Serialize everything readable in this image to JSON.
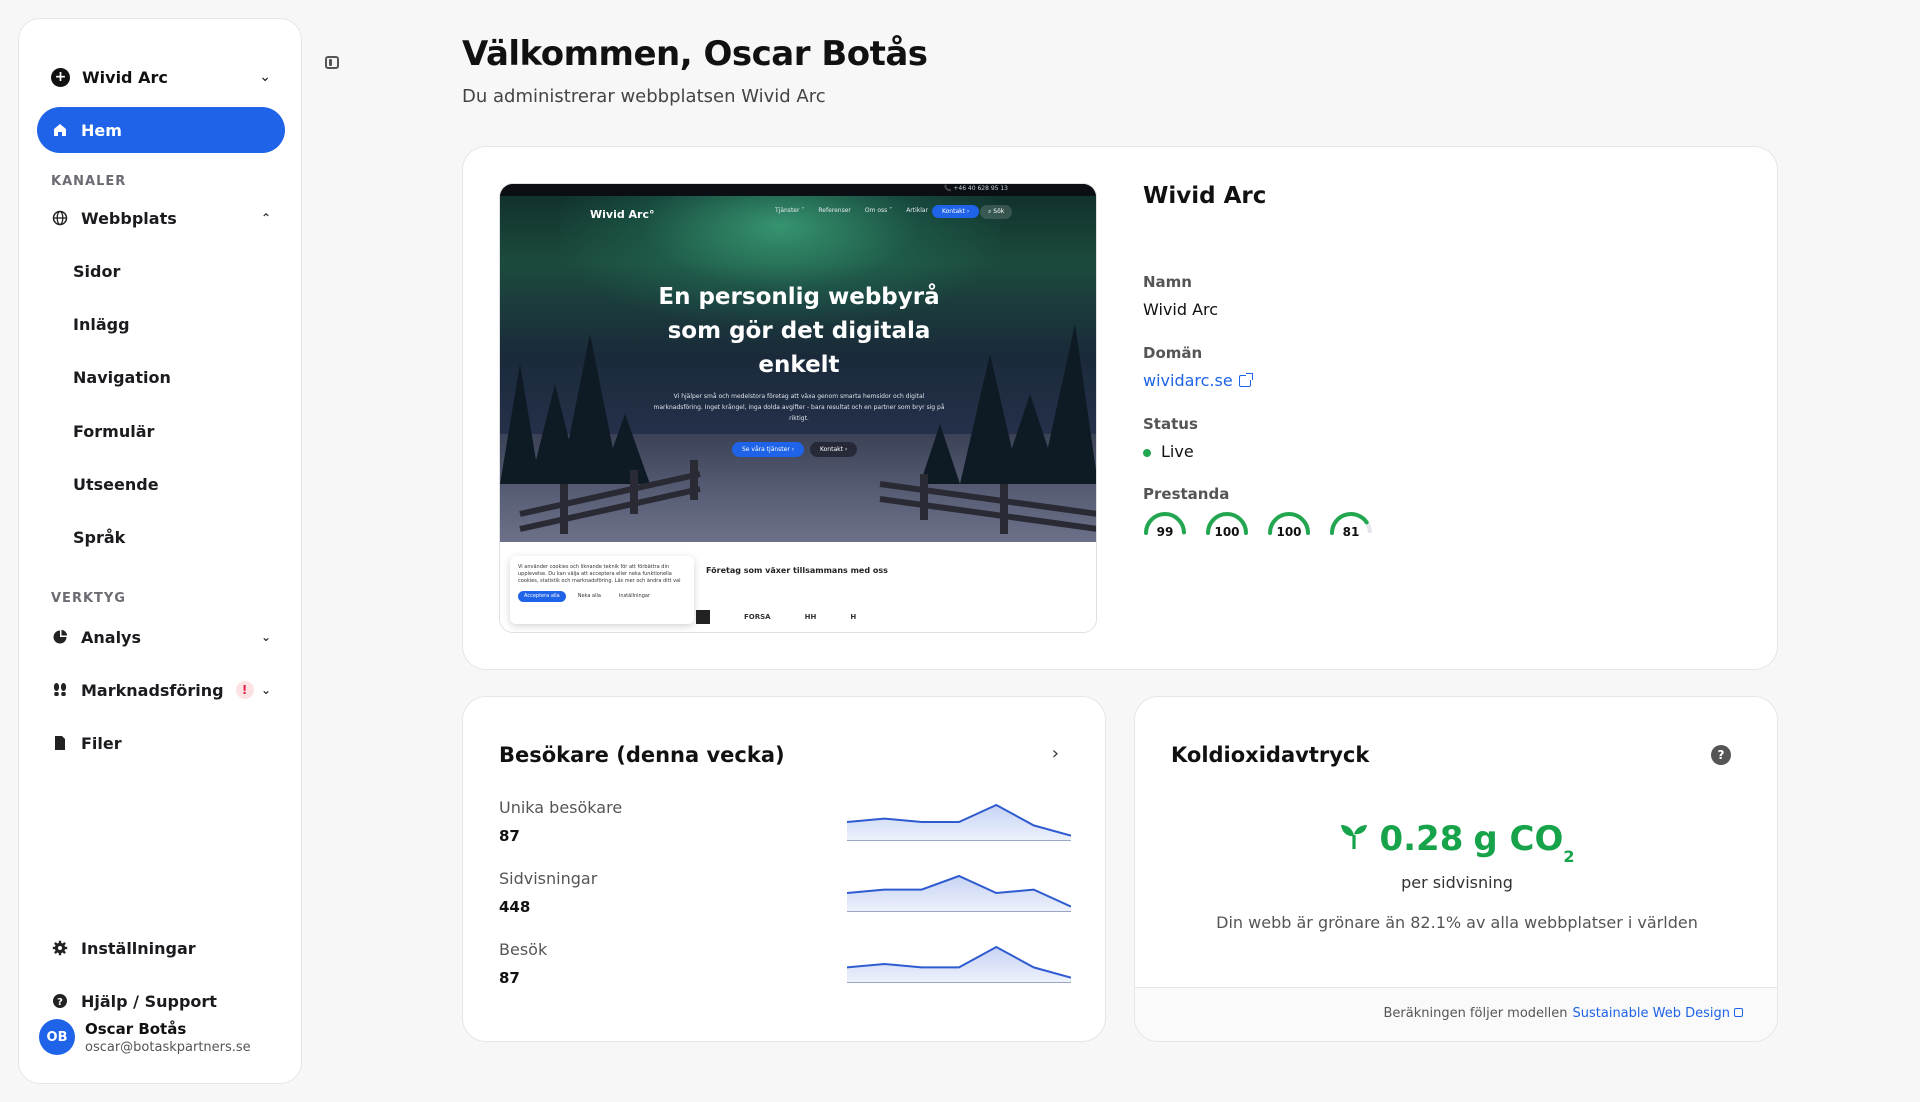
{
  "sidebar": {
    "workspace": "Wivid Arc",
    "home": "Hem",
    "section_channels": "KANALER",
    "website": "Webbplats",
    "sub_items": [
      "Sidor",
      "Inlägg",
      "Navigation",
      "Formulär",
      "Utseende",
      "Språk"
    ],
    "section_tools": "VERKTYG",
    "analytics": "Analys",
    "marketing": "Marknadsföring",
    "marketing_badge": "!",
    "files": "Filer",
    "settings": "Inställningar",
    "help": "Hjälp / Support",
    "user": {
      "initials": "OB",
      "name": "Oscar Botås",
      "email": "oscar@botaskpartners.se"
    }
  },
  "header": {
    "title": "Välkommen, Oscar Botås",
    "subtitle": "Du administrerar webbplatsen Wivid Arc"
  },
  "site": {
    "preview": {
      "phone": "📞 +46 40 628 95 13",
      "logo": "Wivid Arc°",
      "nav": [
        "Tjänster ˅",
        "Referenser",
        "Om oss ˅",
        "Artiklar"
      ],
      "kontakt": "Kontakt ›",
      "search": "⌕ Sök",
      "headline": "En personlig webbyrå som gör det digitala enkelt",
      "body": "Vi hjälper små och medelstora företag att växa genom smarta hemsidor och digital marknadsföring. Inget krångel, inga dolda avgifter - bara resultat och en partner som bryr sig på riktigt.",
      "btn_primary": "Se våra tjänster ›",
      "btn_secondary": "Kontakt ›",
      "cookie_text": "Vi använder cookies och liknande teknik för att förbättra din upplevelse. Du kan välja att acceptera eller neka funktionella cookies, statistik och marknadsföring. Läs mer och ändra ditt val",
      "cookie_accept": "Acceptera alla",
      "cookie_deny": "Neka alla",
      "cookie_settings": "Inställningar",
      "partners_heading": "Företag som växer tillsammans med oss",
      "partner_logos": [
        "FORSA",
        "HH",
        "H"
      ]
    },
    "name": "Wivid Arc",
    "name_label": "Namn",
    "name_value": "Wivid Arc",
    "domain_label": "Domän",
    "domain_value": "wividarc.se",
    "status_label": "Status",
    "status_value": "Live",
    "performance_label": "Prestanda",
    "scores": [
      99,
      100,
      100,
      81
    ]
  },
  "visitors": {
    "title": "Besökare (denna vecka)",
    "metrics": [
      {
        "label": "Unika besökare",
        "value": "87",
        "trend": [
          5,
          6,
          5,
          5,
          10,
          4,
          1
        ]
      },
      {
        "label": "Sidvisningar",
        "value": "448",
        "trend": [
          5,
          6,
          6,
          10,
          5,
          6,
          1
        ]
      },
      {
        "label": "Besök",
        "value": "87",
        "trend": [
          4,
          5,
          4,
          4,
          10,
          4,
          1
        ]
      }
    ]
  },
  "co2": {
    "title": "Koldioxidavtryck",
    "value": "0.28",
    "unit": "g CO",
    "unit_sub": "2",
    "per": "per sidvisning",
    "comparison": "Din webb är grönare än 82.1% av alla webbplatser i världen",
    "footer_prefix": "Beräkningen följer modellen",
    "footer_link": "Sustainable Web Design"
  },
  "colors": {
    "accent": "#1e63e8",
    "green": "#17a34a",
    "score_green": "#22a650"
  }
}
